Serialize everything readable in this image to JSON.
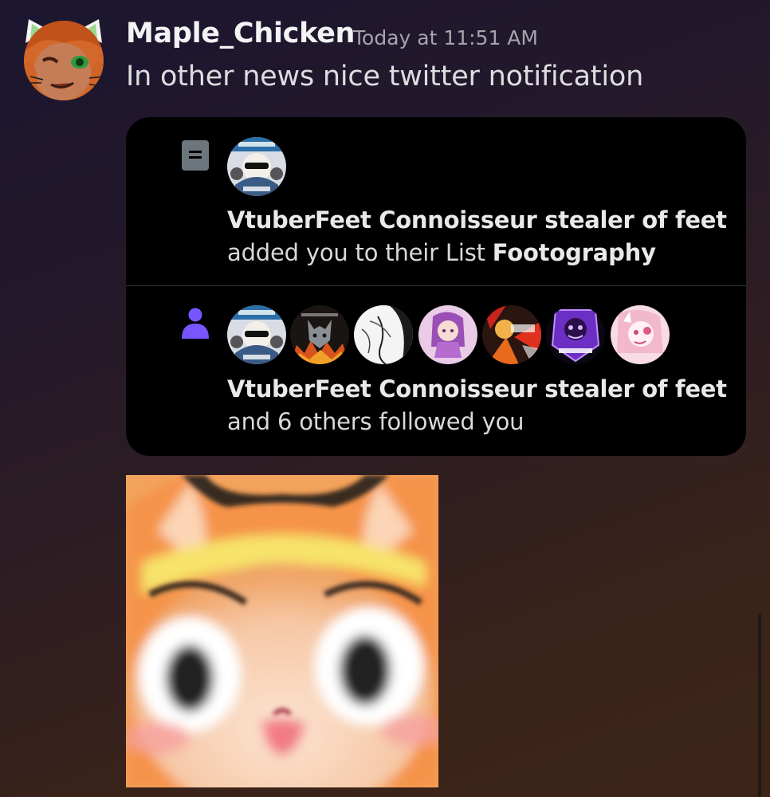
{
  "message": {
    "author": "Maple_Chicken",
    "timestamp": "Today at 11:51 AM",
    "text": "In other news nice twitter notification"
  },
  "embed": {
    "notifications": [
      {
        "icon": "list-icon",
        "actor": "VtuberFeet Connoisseur stealer of feet",
        "text_prefix": "added you to their List ",
        "list_name": "Footography"
      },
      {
        "icon": "person-icon",
        "actor": "VtuberFeet Connoisseur stealer of feet",
        "text": "and 6 others followed you"
      }
    ],
    "follower_avatar_count": 7
  },
  "colors": {
    "username": "#f2f3f5",
    "timestamp": "#a3a6ab",
    "follow_icon": "#7856ff",
    "list_icon": "#6e767d",
    "embed_bg": "#000000"
  },
  "attachment": {
    "type": "sticker-image",
    "description": "blurred orange anime cat-girl face"
  }
}
